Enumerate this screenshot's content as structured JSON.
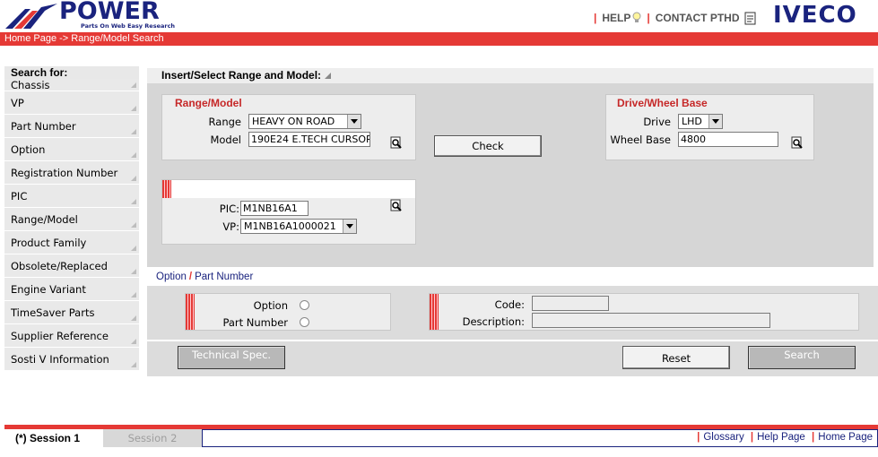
{
  "header": {
    "logo_text": "POWER",
    "logo_tagline": "Parts On Web Easy Research",
    "help": "HELP",
    "contact": "CONTACT PTHD",
    "brand": "IVECO"
  },
  "breadcrumb": "Home Page -> Range/Model Search",
  "sidebar": {
    "title": "Search for:",
    "items": [
      {
        "label": "Chassis"
      },
      {
        "label": "VP"
      },
      {
        "label": "Part Number"
      },
      {
        "label": "Option"
      },
      {
        "label": "Registration Number"
      },
      {
        "label": "PIC"
      },
      {
        "label": "Range/Model"
      },
      {
        "label": "Product Family"
      },
      {
        "label": "Obsolete/Replaced"
      },
      {
        "label": "Engine Variant"
      },
      {
        "label": "TimeSaver Parts"
      },
      {
        "label": "Supplier Reference"
      },
      {
        "label": "Sosti V Information"
      }
    ]
  },
  "main": {
    "title": "Insert/Select Range and Model:",
    "range_model": {
      "title": "Range/Model",
      "range_label": "Range",
      "range_value": "HEAVY ON ROAD",
      "model_label": "Model",
      "model_value": "190E24 E.TECH CURSOR"
    },
    "check_button": "Check",
    "drive_wheelbase": {
      "title": "Drive/Wheel Base",
      "drive_label": "Drive",
      "drive_value": "LHD",
      "wheelbase_label": "Wheel Base",
      "wheelbase_value": "4800"
    },
    "pic": {
      "pic_label": "PIC:",
      "pic_value": "M1NB16A1",
      "vp_label": "VP:",
      "vp_value": "M1NB16A1000021"
    },
    "tabs": {
      "option": "Option",
      "slash": "/",
      "part_number": "Part Number"
    },
    "radios": {
      "option_label": "Option",
      "part_number_label": "Part Number"
    },
    "code_label": "Code:",
    "description_label": "Description:",
    "buttons": {
      "tech_spec": "Technical Spec.",
      "reset": "Reset",
      "search": "Search"
    }
  },
  "footer": {
    "session1": "(*) Session 1",
    "session2": "Session 2",
    "links": [
      "Glossary",
      "Help Page",
      "Home Page"
    ]
  },
  "colors": {
    "accent_red": "#e53935",
    "brand_blue": "#1a237e",
    "panel_grey": "#d6d6d6"
  }
}
